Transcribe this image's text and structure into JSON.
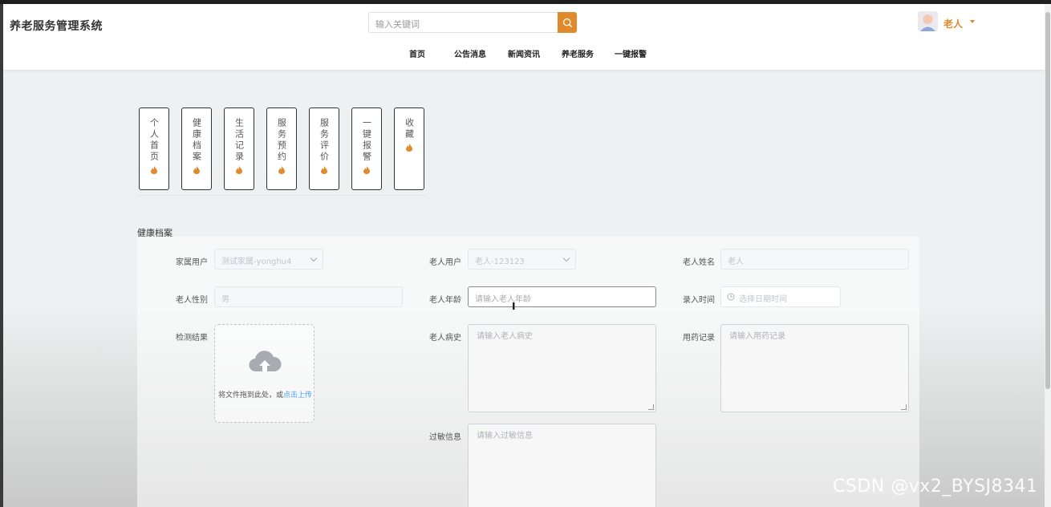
{
  "header": {
    "brand": "养老服务管理系统",
    "search_placeholder": "输入关键词",
    "user_name": "老人"
  },
  "nav": [
    {
      "label": "首页"
    },
    {
      "label": "公告消息"
    },
    {
      "label": "新闻资讯"
    },
    {
      "label": "养老服务"
    },
    {
      "label": "一键报警"
    }
  ],
  "side_tabs": [
    {
      "label": "个人首页"
    },
    {
      "label": "健康档案"
    },
    {
      "label": "生活记录"
    },
    {
      "label": "服务预约"
    },
    {
      "label": "服务评价"
    },
    {
      "label": "一键报警"
    },
    {
      "label": "收藏"
    }
  ],
  "section_title": "健康档案",
  "form": {
    "family_user": {
      "label": "家属用户",
      "value": "测试家属-yonghu4"
    },
    "elder_user": {
      "label": "老人用户",
      "value": "老人-123123"
    },
    "elder_name": {
      "label": "老人姓名",
      "value": "老人"
    },
    "elder_gender": {
      "label": "老人性别",
      "value": "男"
    },
    "elder_age": {
      "label": "老人年龄",
      "placeholder": "请输入老人年龄"
    },
    "entry_time": {
      "label": "录入时间",
      "placeholder": "选择日期时间"
    },
    "test_result": {
      "label": "检测结果",
      "upload_text": "将文件拖到此处，或",
      "upload_link": "点击上传"
    },
    "medical_history": {
      "label": "老人病史",
      "placeholder": "请输入老人病史"
    },
    "medication_record": {
      "label": "用药记录",
      "placeholder": "请输入用药记录"
    },
    "allergy_info": {
      "label": "过敏信息",
      "placeholder": "请输入过敏信息"
    }
  },
  "watermark": "CSDN @vx2_BYSJ8341",
  "colors": {
    "accent": "#e08a2c",
    "link": "#409eff"
  }
}
